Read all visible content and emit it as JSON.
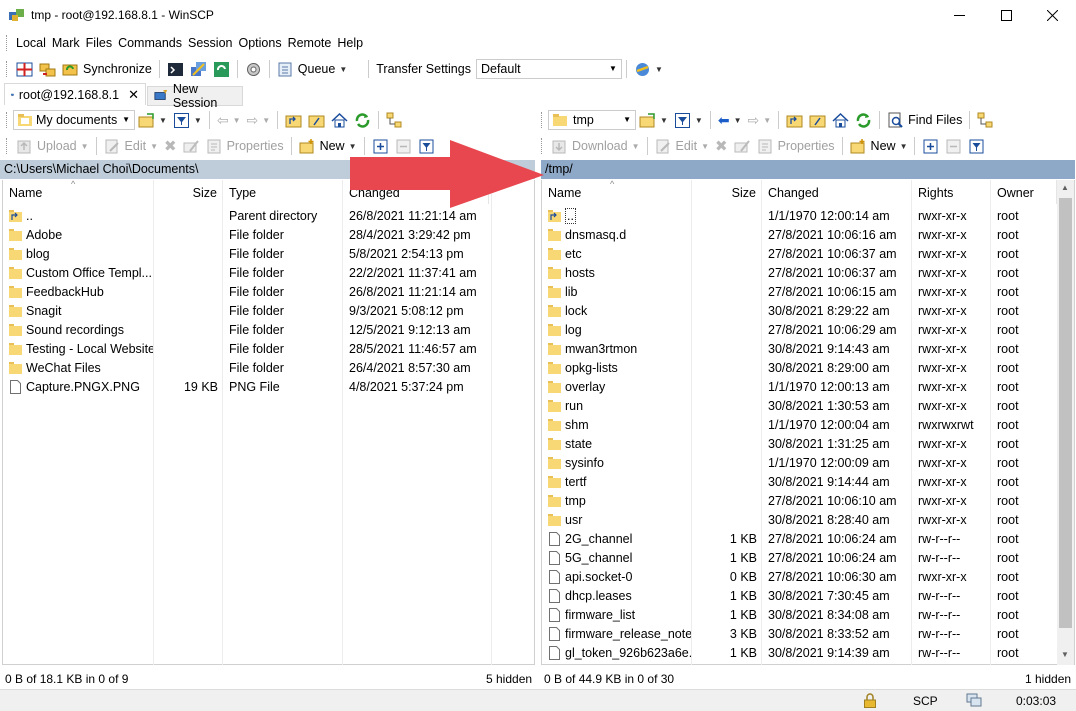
{
  "window": {
    "title": "tmp - root@192.168.8.1 - WinSCP"
  },
  "menu": [
    "Local",
    "Mark",
    "Files",
    "Commands",
    "Session",
    "Options",
    "Remote",
    "Help"
  ],
  "toolbar_main": {
    "synchronize": "Synchronize",
    "queue": "Queue",
    "transfer_label": "Transfer Settings",
    "transfer_value": "Default"
  },
  "tabs": {
    "session": "root@192.168.8.1",
    "new_session": "New Session"
  },
  "left": {
    "location": "My documents",
    "actions": {
      "upload": "Upload",
      "edit": "Edit",
      "properties": "Properties",
      "new": "New"
    },
    "path": "C:\\Users\\Michael Choi\\Documents\\",
    "columns": [
      "Name",
      "Size",
      "Type",
      "Changed"
    ],
    "files": [
      {
        "name": "..",
        "size": "",
        "type": "Parent directory",
        "changed": "26/8/2021  11:21:14 am",
        "kind": "up"
      },
      {
        "name": "Adobe",
        "size": "",
        "type": "File folder",
        "changed": "28/4/2021  3:29:42 pm",
        "kind": "folder"
      },
      {
        "name": "blog",
        "size": "",
        "type": "File folder",
        "changed": "5/8/2021  2:54:13 pm",
        "kind": "folder"
      },
      {
        "name": "Custom Office Templ...",
        "size": "",
        "type": "File folder",
        "changed": "22/2/2021  11:37:41 am",
        "kind": "folder"
      },
      {
        "name": "FeedbackHub",
        "size": "",
        "type": "File folder",
        "changed": "26/8/2021  11:21:14 am",
        "kind": "folder"
      },
      {
        "name": "Snagit",
        "size": "",
        "type": "File folder",
        "changed": "9/3/2021  5:08:12 pm",
        "kind": "folder"
      },
      {
        "name": "Sound recordings",
        "size": "",
        "type": "File folder",
        "changed": "12/5/2021  9:12:13 am",
        "kind": "folder"
      },
      {
        "name": "Testing - Local Website",
        "size": "",
        "type": "File folder",
        "changed": "28/5/2021  11:46:57 am",
        "kind": "folder"
      },
      {
        "name": "WeChat Files",
        "size": "",
        "type": "File folder",
        "changed": "26/4/2021  8:57:30 am",
        "kind": "folder"
      },
      {
        "name": "Capture.PNGX.PNG",
        "size": "19 KB",
        "type": "PNG File",
        "changed": "4/8/2021  5:37:24 pm",
        "kind": "file"
      }
    ],
    "status": "0 B of 18.1 KB in 0 of 9",
    "hidden": "5 hidden"
  },
  "right": {
    "location": "tmp",
    "find_files": "Find Files",
    "actions": {
      "download": "Download",
      "edit": "Edit",
      "properties": "Properties",
      "new": "New"
    },
    "path": "/tmp/",
    "columns": [
      "Name",
      "Size",
      "Changed",
      "Rights",
      "Owner"
    ],
    "files": [
      {
        "name": "..",
        "size": "",
        "changed": "1/1/1970 12:00:14 am",
        "rights": "rwxr-xr-x",
        "owner": "root",
        "kind": "up"
      },
      {
        "name": "dnsmasq.d",
        "size": "",
        "changed": "27/8/2021 10:06:16 am",
        "rights": "rwxr-xr-x",
        "owner": "root",
        "kind": "folder"
      },
      {
        "name": "etc",
        "size": "",
        "changed": "27/8/2021 10:06:37 am",
        "rights": "rwxr-xr-x",
        "owner": "root",
        "kind": "folder"
      },
      {
        "name": "hosts",
        "size": "",
        "changed": "27/8/2021 10:06:37 am",
        "rights": "rwxr-xr-x",
        "owner": "root",
        "kind": "folder"
      },
      {
        "name": "lib",
        "size": "",
        "changed": "27/8/2021 10:06:15 am",
        "rights": "rwxr-xr-x",
        "owner": "root",
        "kind": "folder"
      },
      {
        "name": "lock",
        "size": "",
        "changed": "30/8/2021 8:29:22 am",
        "rights": "rwxr-xr-x",
        "owner": "root",
        "kind": "folder"
      },
      {
        "name": "log",
        "size": "",
        "changed": "27/8/2021 10:06:29 am",
        "rights": "rwxr-xr-x",
        "owner": "root",
        "kind": "folder"
      },
      {
        "name": "mwan3rtmon",
        "size": "",
        "changed": "30/8/2021 9:14:43 am",
        "rights": "rwxr-xr-x",
        "owner": "root",
        "kind": "folder"
      },
      {
        "name": "opkg-lists",
        "size": "",
        "changed": "30/8/2021 8:29:00 am",
        "rights": "rwxr-xr-x",
        "owner": "root",
        "kind": "folder"
      },
      {
        "name": "overlay",
        "size": "",
        "changed": "1/1/1970 12:00:13 am",
        "rights": "rwxr-xr-x",
        "owner": "root",
        "kind": "folder"
      },
      {
        "name": "run",
        "size": "",
        "changed": "30/8/2021 1:30:53 am",
        "rights": "rwxr-xr-x",
        "owner": "root",
        "kind": "folder"
      },
      {
        "name": "shm",
        "size": "",
        "changed": "1/1/1970 12:00:04 am",
        "rights": "rwxrwxrwt",
        "owner": "root",
        "kind": "folder"
      },
      {
        "name": "state",
        "size": "",
        "changed": "30/8/2021 1:31:25 am",
        "rights": "rwxr-xr-x",
        "owner": "root",
        "kind": "folder"
      },
      {
        "name": "sysinfo",
        "size": "",
        "changed": "1/1/1970 12:00:09 am",
        "rights": "rwxr-xr-x",
        "owner": "root",
        "kind": "folder"
      },
      {
        "name": "tertf",
        "size": "",
        "changed": "30/8/2021 9:14:44 am",
        "rights": "rwxr-xr-x",
        "owner": "root",
        "kind": "folder"
      },
      {
        "name": "tmp",
        "size": "",
        "changed": "27/8/2021 10:06:10 am",
        "rights": "rwxr-xr-x",
        "owner": "root",
        "kind": "folder"
      },
      {
        "name": "usr",
        "size": "",
        "changed": "30/8/2021 8:28:40 am",
        "rights": "rwxr-xr-x",
        "owner": "root",
        "kind": "folder"
      },
      {
        "name": "2G_channel",
        "size": "1 KB",
        "changed": "27/8/2021 10:06:24 am",
        "rights": "rw-r--r--",
        "owner": "root",
        "kind": "file"
      },
      {
        "name": "5G_channel",
        "size": "1 KB",
        "changed": "27/8/2021 10:06:24 am",
        "rights": "rw-r--r--",
        "owner": "root",
        "kind": "file"
      },
      {
        "name": "api.socket-0",
        "size": "0 KB",
        "changed": "27/8/2021 10:06:30 am",
        "rights": "rwxr-xr-x",
        "owner": "root",
        "kind": "file"
      },
      {
        "name": "dhcp.leases",
        "size": "1 KB",
        "changed": "30/8/2021 7:30:45 am",
        "rights": "rw-r--r--",
        "owner": "root",
        "kind": "file"
      },
      {
        "name": "firmware_list",
        "size": "1 KB",
        "changed": "30/8/2021 8:34:08 am",
        "rights": "rw-r--r--",
        "owner": "root",
        "kind": "file"
      },
      {
        "name": "firmware_release_note",
        "size": "3 KB",
        "changed": "30/8/2021 8:33:52 am",
        "rights": "rw-r--r--",
        "owner": "root",
        "kind": "file"
      },
      {
        "name": "gl_token_926b623a6e...",
        "size": "1 KB",
        "changed": "30/8/2021 9:14:39 am",
        "rights": "rw-r--r--",
        "owner": "root",
        "kind": "file"
      }
    ],
    "status": "0 B of 44.9 KB in 0 of 30",
    "hidden": "1 hidden"
  },
  "bottom": {
    "protocol": "SCP",
    "elapsed": "0:03:03"
  },
  "colors": {
    "folder": "#f8d775",
    "arrow": "#e8474f",
    "path_left": "#bfcddb",
    "path_right": "#8ea8c8"
  }
}
